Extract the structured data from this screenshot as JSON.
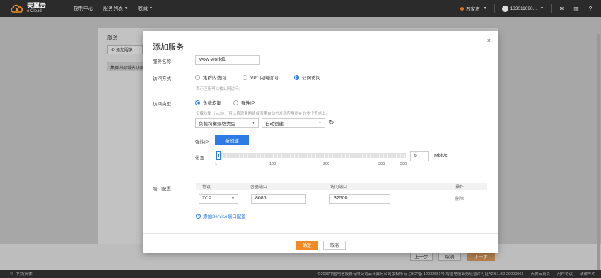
{
  "topbar": {
    "logo_cn": "天翼云",
    "logo_en": "e Cloud",
    "console": "控制中心",
    "service_list": "服务列表",
    "favorites": "收藏",
    "region": "石家庄",
    "user": "133011690..."
  },
  "background": {
    "panel_title": "服务",
    "add_service": "添加服务",
    "table_head": "集群内部域名访问",
    "prev_step": "上一步",
    "cancel": "取消",
    "next_step": "下一步"
  },
  "modal": {
    "title": "添加服务",
    "service_name_label": "服务名称",
    "service_name_value": "wow-world1",
    "access_mode_label": "访问方式",
    "access_options": [
      "集群内访问",
      "VPC内网访问",
      "公网访问"
    ],
    "access_selected": "公网访问",
    "access_hint": "表示应用可以被公网访问。",
    "access_type_label": "访问类型",
    "type_options": [
      "负载均衡",
      "弹性IP"
    ],
    "type_selected": "负载均衡",
    "lb_hint": "负载均衡（ELB）：可以将流量网络或流量自动分发到应用所在的多个节点上。",
    "lb_spec": "负载均衡规格类型",
    "auto_create": "自动创建",
    "eip_label": "弹性IP",
    "new_create": "新创建",
    "bandwidth_label": "带宽",
    "bandwidth_ticks": [
      "1",
      "100",
      "200",
      "300",
      "500"
    ],
    "bandwidth_value": "5",
    "bandwidth_unit": "Mbit/s",
    "port_label": "端口配置",
    "port_headers": [
      "协议",
      "容器端口",
      "访问端口",
      "操作"
    ],
    "port_row": {
      "protocol": "TCP",
      "container_port": "8085",
      "access_port": "32500",
      "action": "删除"
    },
    "add_port": "添加Service端口配置",
    "confirm": "确定",
    "cancel": "取消"
  },
  "footer": {
    "lang": "中文(简体)",
    "copyright": "©2019中国电信股份有限公司云计算分公司版权所有  京ICP备 12022551号  增值电信业务经营许可证A2.B1.B2-20090001",
    "links": [
      "天翼云首页",
      "用户协议",
      "法律声明"
    ]
  },
  "bandwidth_level": 5,
  "colors": {
    "accent": "#2e7be5",
    "orange": "#f08a24",
    "nav_bg": "#2b2b2b"
  }
}
